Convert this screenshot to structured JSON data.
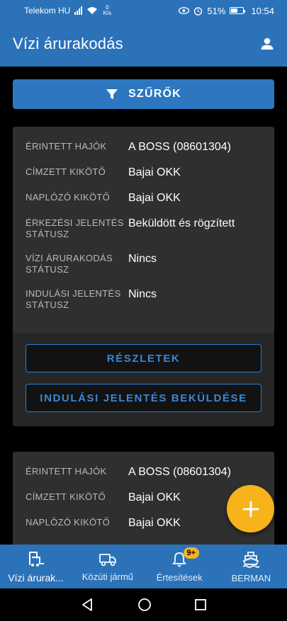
{
  "status_bar": {
    "carrier": "Telekom HU",
    "speed_value": "0",
    "speed_unit": "K/s",
    "battery": "51%",
    "time": "10:54"
  },
  "app_bar": {
    "title": "Vízi árurakodás",
    "account_icon": "account-icon"
  },
  "filter": {
    "label": "SZŰRŐK",
    "icon": "filter-icon"
  },
  "cards": [
    {
      "fields": [
        {
          "label": "ÉRINTETT HAJÓK",
          "value": "A BOSS (08601304)"
        },
        {
          "label": "CÍMZETT KIKÖTŐ",
          "value": "Bajai OKK"
        },
        {
          "label": "NAPLÓZÓ KIKÖTŐ",
          "value": "Bajai OKK"
        },
        {
          "label": "ÉRKEZÉSI JELENTÉS STÁTUSZ",
          "value": "Beküldött és rögzített"
        },
        {
          "label": "VÍZI ÁRURAKODÁS STÁTUSZ",
          "value": "Nincs"
        },
        {
          "label": "INDULÁSI JELENTÉS STÁTUSZ",
          "value": "Nincs"
        }
      ],
      "actions": {
        "details": "RÉSZLETEK",
        "submit_departure": "INDULÁSI JELENTÉS BEKÜLDÉSE"
      }
    },
    {
      "fields": [
        {
          "label": "ÉRINTETT HAJÓK",
          "value": "A BOSS (08601304)"
        },
        {
          "label": "CÍMZETT KIKÖTŐ",
          "value": "Bajai OKK"
        },
        {
          "label": "NAPLÓZÓ KIKÖTŐ",
          "value": "Bajai OKK"
        }
      ]
    }
  ],
  "fab": {
    "icon": "plus-icon"
  },
  "bottom_nav": [
    {
      "label": "Vízi árurak...",
      "icon": "forklift-icon",
      "active": true
    },
    {
      "label": "Közúti jármű",
      "icon": "truck-icon"
    },
    {
      "label": "Értesítések",
      "icon": "bell-icon",
      "badge": "9+"
    },
    {
      "label": "BERMAN",
      "icon": "ship-icon"
    }
  ],
  "colors": {
    "primary": "#2b72b9",
    "accent": "#f7b21c",
    "card": "#2f2f2f",
    "outline": "#2e7ed0"
  }
}
